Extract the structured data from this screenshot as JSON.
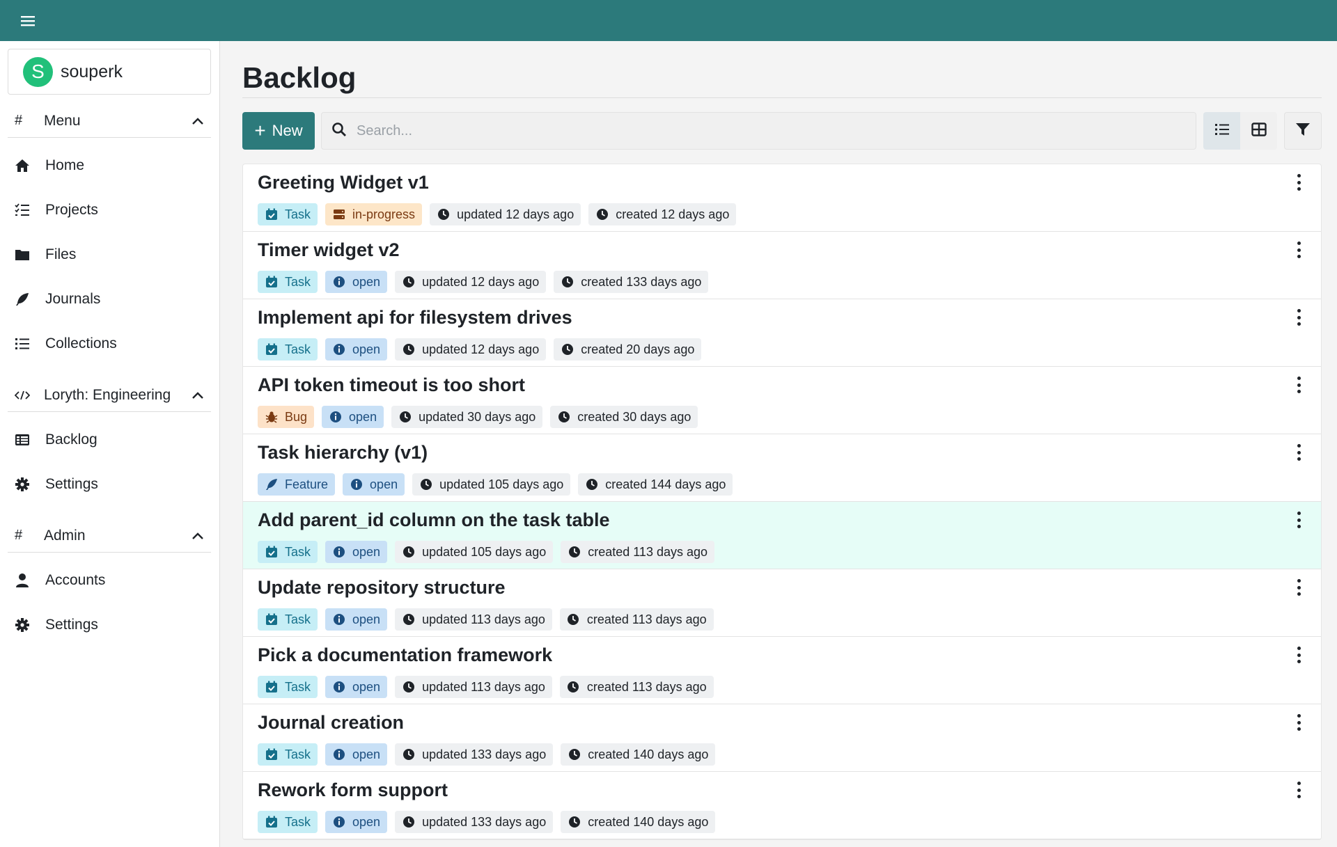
{
  "user": {
    "initial": "S",
    "name": "souperk"
  },
  "sidebar": {
    "sections": [
      {
        "title": "Menu",
        "items": [
          {
            "label": "Home",
            "icon": "home-icon"
          },
          {
            "label": "Projects",
            "icon": "checklist-icon"
          },
          {
            "label": "Files",
            "icon": "folder-icon"
          },
          {
            "label": "Journals",
            "icon": "feather-icon"
          },
          {
            "label": "Collections",
            "icon": "list-icon"
          }
        ]
      },
      {
        "title": "Loryth: Engineering",
        "items": [
          {
            "label": "Backlog",
            "icon": "table-icon"
          },
          {
            "label": "Settings",
            "icon": "gear-icon"
          }
        ]
      },
      {
        "title": "Admin",
        "items": [
          {
            "label": "Accounts",
            "icon": "user-icon"
          },
          {
            "label": "Settings",
            "icon": "gear-icon"
          }
        ]
      }
    ]
  },
  "page": {
    "title": "Backlog"
  },
  "toolbar": {
    "new_label": "New",
    "search_placeholder": "Search..."
  },
  "colors": {
    "accent": "#2c7a7b",
    "highlight_row": "#e6fdf7",
    "avatar": "#21c07a"
  },
  "items": [
    {
      "title": "Greeting Widget v1",
      "type": "Task",
      "status": "in-progress",
      "updated": "updated 12 days ago",
      "created": "created 12 days ago"
    },
    {
      "title": "Timer widget v2",
      "type": "Task",
      "status": "open",
      "updated": "updated 12 days ago",
      "created": "created 133 days ago"
    },
    {
      "title": "Implement api for filesystem drives",
      "type": "Task",
      "status": "open",
      "updated": "updated 12 days ago",
      "created": "created 20 days ago"
    },
    {
      "title": "API token timeout is too short",
      "type": "Bug",
      "status": "open",
      "updated": "updated 30 days ago",
      "created": "created 30 days ago"
    },
    {
      "title": "Task hierarchy (v1)",
      "type": "Feature",
      "status": "open",
      "updated": "updated 105 days ago",
      "created": "created 144 days ago"
    },
    {
      "title": "Add parent_id column on the task table",
      "type": "Task",
      "status": "open",
      "updated": "updated 105 days ago",
      "created": "created 113 days ago",
      "highlighted": true
    },
    {
      "title": "Update repository structure",
      "type": "Task",
      "status": "open",
      "updated": "updated 113 days ago",
      "created": "created 113 days ago"
    },
    {
      "title": "Pick a documentation framework",
      "type": "Task",
      "status": "open",
      "updated": "updated 113 days ago",
      "created": "created 113 days ago"
    },
    {
      "title": "Journal creation",
      "type": "Task",
      "status": "open",
      "updated": "updated 133 days ago",
      "created": "created 140 days ago"
    },
    {
      "title": "Rework form support",
      "type": "Task",
      "status": "open",
      "updated": "updated 133 days ago",
      "created": "created 140 days ago"
    }
  ]
}
